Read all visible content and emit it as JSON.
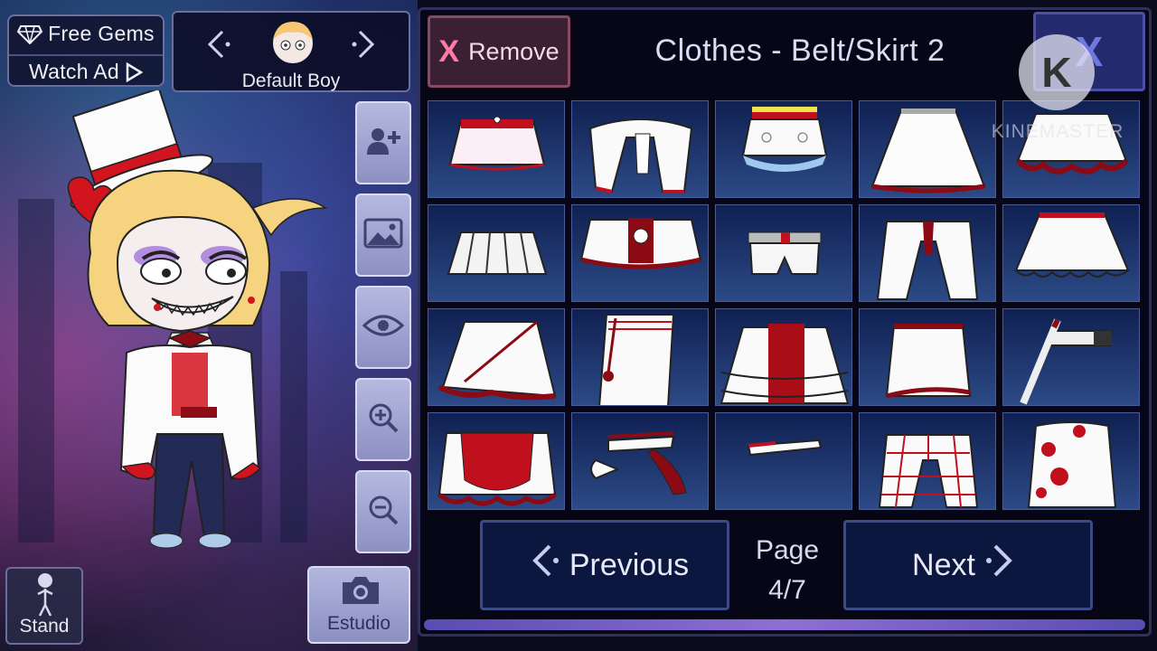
{
  "top_left": {
    "free_gems_label": "Free Gems",
    "watch_ad_label": "Watch Ad"
  },
  "character": {
    "name": "Default Boy",
    "prev_arrow": "‹",
    "next_arrow": "›"
  },
  "side_buttons": [
    {
      "icon": "add-person-icon"
    },
    {
      "icon": "image-icon"
    },
    {
      "icon": "eye-icon"
    },
    {
      "icon": "zoom-in-icon"
    },
    {
      "icon": "zoom-out-icon"
    }
  ],
  "bottom_left": {
    "stand_label": "Stand",
    "studio_label": "Estudio"
  },
  "panel": {
    "remove_label": "Remove",
    "remove_x": "X",
    "title": "Clothes - Belt/Skirt 2",
    "close_label": "X",
    "prev_label": "Previous",
    "next_label": "Next",
    "page_label": "Page",
    "page_value": "4/7"
  },
  "items": [
    {
      "icon": "pink-skirt-heart-icon"
    },
    {
      "icon": "tied-sash-icon"
    },
    {
      "icon": "lace-skirt-icon"
    },
    {
      "icon": "white-flared-skirt-icon"
    },
    {
      "icon": "ruffle-trim-skirt-icon"
    },
    {
      "icon": "pleated-skirt-icon"
    },
    {
      "icon": "yin-yang-apron-icon"
    },
    {
      "icon": "belt-shorts-icon"
    },
    {
      "icon": "tie-skirt-icon"
    },
    {
      "icon": "lace-hem-skirt-icon"
    },
    {
      "icon": "wrap-ruffle-skirt-icon"
    },
    {
      "icon": "tassel-pencil-skirt-icon"
    },
    {
      "icon": "tiered-frill-skirt-icon"
    },
    {
      "icon": "red-trim-pencil-skirt-icon"
    },
    {
      "icon": "sword-belt-icon"
    },
    {
      "icon": "red-apron-icon"
    },
    {
      "icon": "holster-belt-icon"
    },
    {
      "icon": "thin-belt-icon"
    },
    {
      "icon": "plaid-tie-skirt-icon"
    },
    {
      "icon": "red-dot-skirt-icon"
    }
  ],
  "watermark": {
    "logo_letter": "K",
    "text": "KINEMASTER"
  },
  "colors": {
    "accent_red": "#c0101e",
    "panel_bg": "#060616",
    "cell_top": "#102052",
    "cell_bottom": "#2c4a86"
  }
}
